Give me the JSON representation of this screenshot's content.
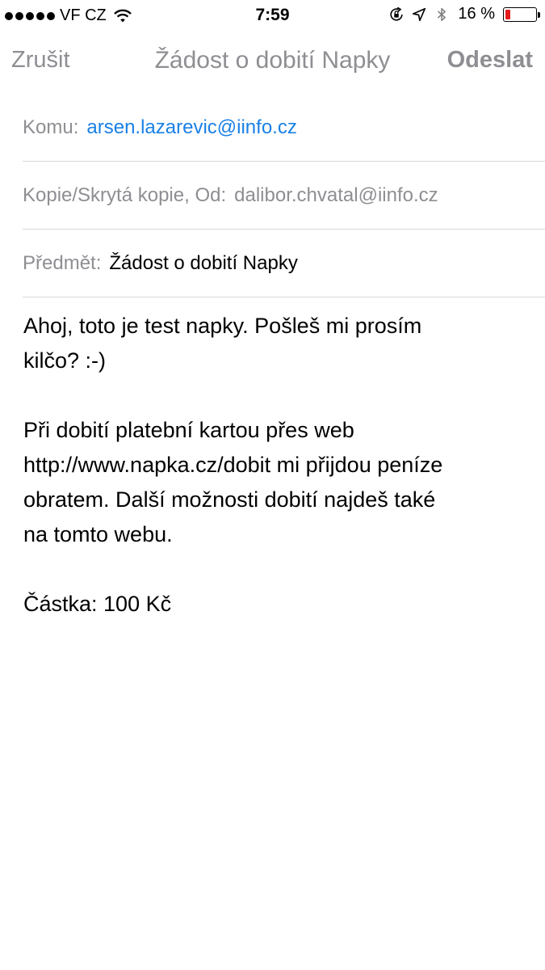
{
  "status_bar": {
    "carrier": "VF CZ",
    "time": "7:59",
    "battery_percent_text": "16 %",
    "battery_level": 0.16,
    "battery_color": "#e31b1b",
    "icons": [
      "signal-dots",
      "wifi-icon",
      "rotation-lock-icon",
      "location-arrow-icon",
      "bluetooth-icon",
      "battery-icon"
    ]
  },
  "nav": {
    "cancel_label": "Zrušit",
    "title": "Žádost o dobití Napky",
    "send_label": "Odeslat"
  },
  "fields": {
    "to_label": "Komu:",
    "to_value": "arsen.lazarevic@iinfo.cz",
    "cc_label": "Kopie/Skrytá kopie, Od:",
    "cc_value": "dalibor.chvatal@iinfo.cz",
    "subject_label": "Předmět:",
    "subject_value": "Žádost o dobití Napky"
  },
  "body": {
    "paragraph1": "Ahoj, toto je test napky. Pošleš mi prosím\nkilčo? :-)",
    "paragraph2": "Při dobití platební kartou přes web\nhttp://www.napka.cz/dobit mi přijdou peníze\nobratem. Další možnosti dobití najdeš také\nna tomto webu.",
    "paragraph3": "Částka: 100 Kč"
  },
  "colors": {
    "link": "#1a80e6",
    "muted": "#8e8e93",
    "separator": "#d9d9de"
  }
}
